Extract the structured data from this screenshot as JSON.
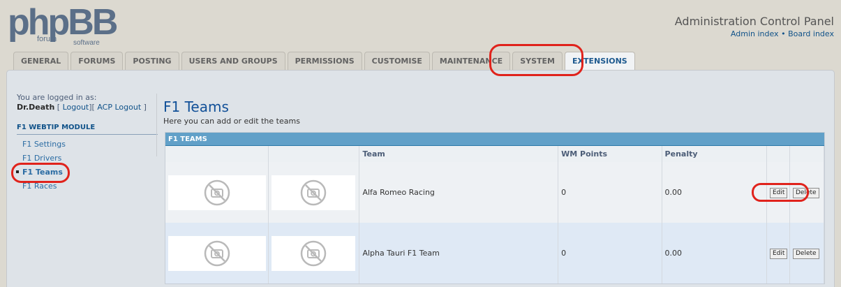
{
  "header": {
    "logo_main": "phpBB",
    "logo_sub": "forum",
    "logo_sub2": "software",
    "acp_title": "Administration Control Panel",
    "admin_index": "Admin index",
    "separator": "•",
    "board_index": "Board index"
  },
  "tabs": [
    {
      "label": "GENERAL"
    },
    {
      "label": "FORUMS"
    },
    {
      "label": "POSTING"
    },
    {
      "label": "USERS AND GROUPS"
    },
    {
      "label": "PERMISSIONS"
    },
    {
      "label": "CUSTOMISE"
    },
    {
      "label": "MAINTENANCE"
    },
    {
      "label": "SYSTEM"
    },
    {
      "label": "EXTENSIONS"
    }
  ],
  "sidebar": {
    "logged_in_label": "You are logged in as:",
    "username": "Dr.Death",
    "logout": "Logout",
    "acp_logout": "ACP Logout",
    "bracket_open": "[",
    "bracket_mid": "][",
    "bracket_close": "]",
    "module_title": "F1 WEBTIP MODULE",
    "items": [
      {
        "label": "F1 Settings"
      },
      {
        "label": "F1 Drivers"
      },
      {
        "label": "F1 Teams"
      },
      {
        "label": "F1 Races"
      }
    ]
  },
  "main": {
    "title": "F1 Teams",
    "description": "Here you can add or edit the teams",
    "table_caption": "F1 TEAMS",
    "columns": [
      "",
      "",
      "Team",
      "WM Points",
      "Penalty",
      ""
    ],
    "rows": [
      {
        "team": "Alfa Romeo Racing",
        "wm_points": "0",
        "penalty": "0.00",
        "edit": "Edit",
        "delete": "Delete"
      },
      {
        "team": "Alpha Tauri F1 Team",
        "wm_points": "0",
        "penalty": "0.00",
        "edit": "Edit",
        "delete": "Delete"
      }
    ]
  },
  "colors": {
    "accent": "#105289",
    "annotation": "#e0231c",
    "caption_bar": "#61a0c8"
  },
  "icons": [
    "no-image-icon"
  ]
}
